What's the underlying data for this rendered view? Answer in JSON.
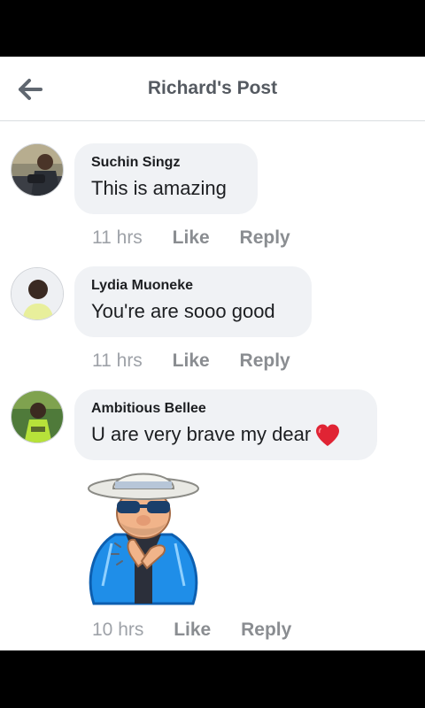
{
  "header": {
    "title": "Richard's Post",
    "back_icon": "arrow-left-icon"
  },
  "comments": [
    {
      "author": "Suchin Singz",
      "text": "This is amazing",
      "time": "11 hrs",
      "like": "Like",
      "reply": "Reply"
    },
    {
      "author": "Lydia Muoneke",
      "text": "You're are sooo good",
      "time": "11 hrs",
      "like": "Like",
      "reply": "Reply"
    },
    {
      "author": "Ambitious Bellee",
      "text": "U are very brave my dear",
      "emoji": "red-heart-icon",
      "time": "10 hrs",
      "like": "Like",
      "reply": "Reply",
      "sticker": "old-man-clapping-sticker"
    }
  ],
  "colors": {
    "bubble": "#f0f2f5",
    "meta": "#8a8d91",
    "title": "#555a61",
    "heart": "#e02434"
  }
}
